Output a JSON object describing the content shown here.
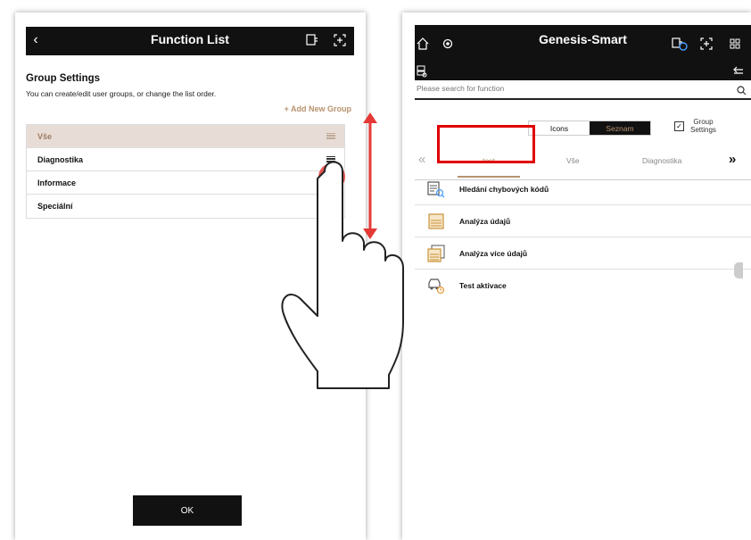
{
  "left_panel": {
    "title": "Function List",
    "section_title": "Group Settings",
    "section_description": "You can create/edit user groups, or change the list order.",
    "add_group_label": "+ Add New Group",
    "groups": [
      {
        "label": "Vše",
        "selected": true
      },
      {
        "label": "Diagnostika",
        "selected": false
      },
      {
        "label": "Informace",
        "selected": false
      },
      {
        "label": "Speciální",
        "selected": false
      }
    ],
    "ok_label": "OK"
  },
  "right_panel": {
    "title": "Genesis-Smart",
    "search_placeholder": "Please search for function",
    "view_toggle": {
      "icons_label": "Icons",
      "list_label": "Seznam",
      "active": "Seznam"
    },
    "group_settings_label_line1": "Group",
    "group_settings_label_line2": "Settings",
    "group_settings_checked": true,
    "tabs": [
      {
        "label": "test",
        "selected": true
      },
      {
        "label": "Vše",
        "selected": false
      },
      {
        "label": "Diagnostika",
        "selected": false
      }
    ],
    "functions": [
      {
        "label": "Hledání chybových kódů",
        "icon": "fault-code-search-icon"
      },
      {
        "label": "Analýza údajů",
        "icon": "data-analysis-icon"
      },
      {
        "label": "Analýza více údajů",
        "icon": "multi-data-analysis-icon"
      },
      {
        "label": "Test aktivace",
        "icon": "activation-test-icon"
      }
    ]
  },
  "colors": {
    "accent": "#b7936f",
    "highlight_red": "#e00000",
    "gesture_red": "#e53935",
    "topbar": "#111111"
  }
}
